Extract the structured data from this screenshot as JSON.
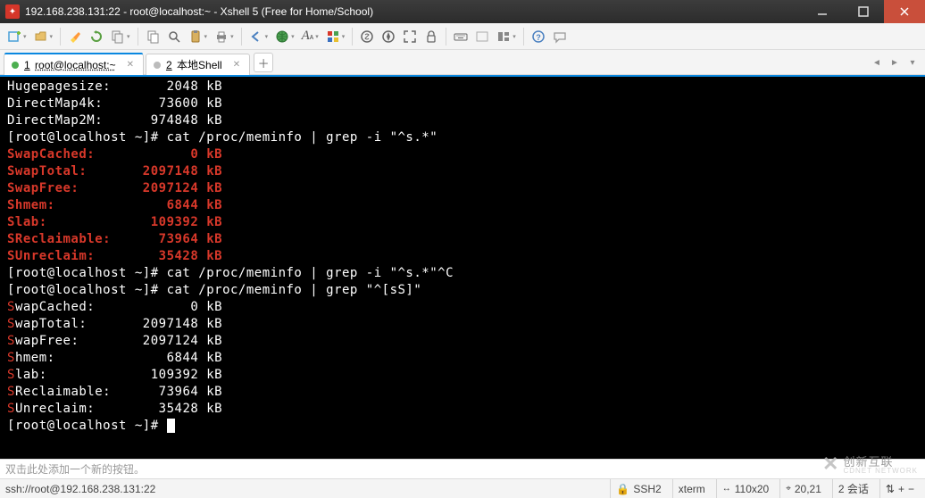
{
  "titlebar": {
    "text": "192.168.238.131:22 - root@localhost:~ - Xshell 5 (Free for Home/School)"
  },
  "toolbar": {
    "icons": [
      "new",
      "open",
      "",
      "copy-small",
      "clip",
      "refresh",
      "",
      "copy",
      "search",
      "paste",
      "print",
      "",
      "back",
      "globe",
      "font",
      "color",
      "",
      "shell1",
      "compass",
      "fullscreen",
      "lock",
      "",
      "keyboard",
      "blank",
      "panes",
      "",
      "help",
      "feedback"
    ]
  },
  "tabs": {
    "active": {
      "num": "1",
      "label": "root@localhost:~"
    },
    "second": {
      "num": "2",
      "label": "本地Shell"
    }
  },
  "terminal": [
    {
      "t": "plain",
      "text": "Hugepagesize:       2048 kB"
    },
    {
      "t": "plain",
      "text": "DirectMap4k:       73600 kB"
    },
    {
      "t": "plain",
      "text": "DirectMap2M:      974848 kB"
    },
    {
      "t": "plain",
      "text": "[root@localhost ~]# cat /proc/meminfo | grep -i \"^s.*\""
    },
    {
      "t": "red",
      "text": "SwapCached:            0 kB"
    },
    {
      "t": "red",
      "text": "SwapTotal:       2097148 kB"
    },
    {
      "t": "red",
      "text": "SwapFree:        2097124 kB"
    },
    {
      "t": "red",
      "text": "Shmem:              6844 kB"
    },
    {
      "t": "red",
      "text": "Slab:             109392 kB"
    },
    {
      "t": "red",
      "text": "SReclaimable:      73964 kB"
    },
    {
      "t": "red",
      "text": "SUnreclaim:        35428 kB"
    },
    {
      "t": "plain",
      "text": "[root@localhost ~]# cat /proc/meminfo | grep -i \"^s.*\"^C"
    },
    {
      "t": "plain",
      "text": "[root@localhost ~]# cat /proc/meminfo | grep \"^[sS]\""
    },
    {
      "t": "sline",
      "s": "S",
      "rest": "wapCached:            0 kB"
    },
    {
      "t": "sline",
      "s": "S",
      "rest": "wapTotal:       2097148 kB"
    },
    {
      "t": "sline",
      "s": "S",
      "rest": "wapFree:        2097124 kB"
    },
    {
      "t": "sline",
      "s": "S",
      "rest": "hmem:              6844 kB"
    },
    {
      "t": "sline",
      "s": "S",
      "rest": "lab:             109392 kB"
    },
    {
      "t": "sline",
      "s": "S",
      "rest": "Reclaimable:      73964 kB"
    },
    {
      "t": "sline",
      "s": "S",
      "rest": "Unreclaim:        35428 kB"
    },
    {
      "t": "prompt",
      "text": "[root@localhost ~]# "
    }
  ],
  "compose": {
    "placeholder": "双击此处添加一个新的按钮。"
  },
  "status": {
    "path": "ssh://root@192.168.238.131:22",
    "proto": "SSH2",
    "term": "xterm",
    "size": "110x20",
    "pos": "20,21",
    "sess": "2 会话",
    "arrows": "⇅",
    "lock": "🔒",
    "plus": "+",
    "minus": "−",
    "caret_l": "◄",
    "caret_r": "►"
  },
  "watermark": {
    "brand": "创新互联",
    "sub": "CDNET NETWORK"
  }
}
